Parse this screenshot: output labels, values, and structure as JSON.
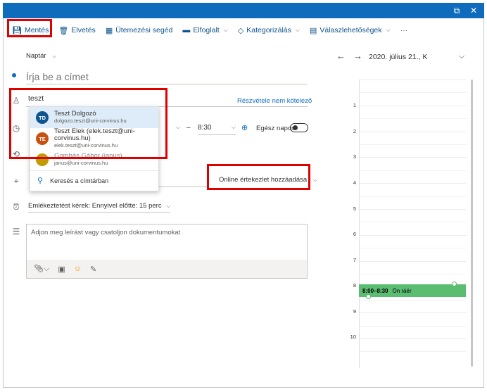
{
  "toolbar": {
    "items": [
      {
        "label": "Mentés",
        "icon": "save-icon"
      },
      {
        "label": "Elvetés",
        "icon": "trash-icon"
      },
      {
        "label": "Ütemezési segéd",
        "icon": "scheduling-icon"
      },
      {
        "label": "Elfoglalt",
        "icon": "busy-icon"
      },
      {
        "label": "Kategorizálás",
        "icon": "tag-icon"
      },
      {
        "label": "Válaszlehetőségek",
        "icon": "response-options-icon"
      }
    ],
    "more": "···"
  },
  "form": {
    "calendar_label": "Naptár",
    "title_placeholder": "Írja be a címet",
    "attendee_value": "teszt",
    "optional_link": "Részvétele nem kötelező",
    "end_time": "8:30",
    "all_day_label": "Egész napos",
    "online_meeting": "Online értekezlet hozzáadása",
    "reminder": "Emlékeztetést kérek: Ennyivel előtte: 15 perc",
    "description_placeholder": "Adjon meg leírást vagy csatoljon dokumentumokat"
  },
  "suggestions": [
    {
      "initials": "TD",
      "name": "Teszt Dolgozó",
      "email": "dolgozo.teszt@uni-corvinus.hu",
      "color": "#0f548c"
    },
    {
      "initials": "TE",
      "name": "Teszt Elek (elek.teszt@uni-corvinus.hu)",
      "email": "elek.teszt@uni-corvinus.hu",
      "color": "#ca5010"
    },
    {
      "initials": "",
      "name": "Gombás Gábor (janus)",
      "email": "janus@uni-corvinus.hu",
      "color": "#c19c00"
    }
  ],
  "directory_search": "Keresés a címtárban",
  "calendar": {
    "date": "2020. július 21., K",
    "hours": [
      "1",
      "2",
      "3",
      "4",
      "5",
      "6",
      "7",
      "8",
      "9",
      "10"
    ],
    "event_time": "8:00–8:30",
    "event_label": "Ön ráér"
  },
  "colors": {
    "accent": "#0f6cbd",
    "highlight_box": "#e00000",
    "event_green": "#5bbd72"
  }
}
